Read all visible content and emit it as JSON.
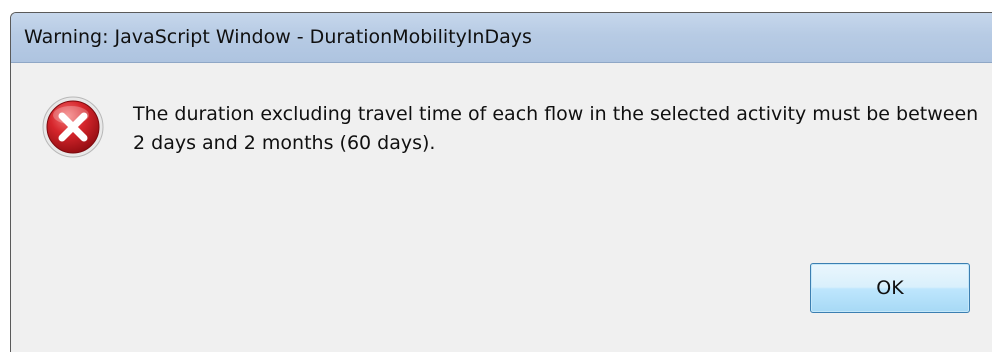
{
  "window": {
    "title": "Warning: JavaScript Window - DurationMobilityInDays"
  },
  "dialog": {
    "icon": "error-icon",
    "message": "The duration excluding travel time of each flow in the selected activity must be between 2 days and 2 months (60 days).",
    "ok_label": "OK"
  },
  "colors": {
    "titlebar": "#b9cde5",
    "body": "#f0f0f0",
    "error_red": "#c8141e",
    "button_border": "#3c7fb1"
  }
}
